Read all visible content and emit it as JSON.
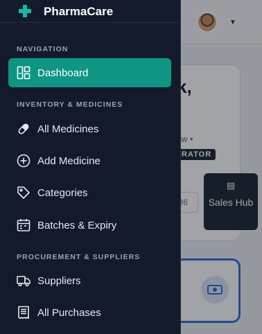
{
  "app": {
    "name": "PharmaCare"
  },
  "background": {
    "heading_line1": "k,",
    "heading_line2": "!",
    "subtitle": "rview •",
    "role_badge": "STRATOR",
    "pill_text": "36",
    "sales_hub_label": "Sales Hub"
  },
  "sidebar": {
    "sections": [
      {
        "title": "NAVIGATION",
        "items": [
          {
            "label": "Dashboard",
            "icon": "dashboard-icon",
            "active": true
          }
        ]
      },
      {
        "title": "INVENTORY & MEDICINES",
        "items": [
          {
            "label": "All Medicines",
            "icon": "pill-icon",
            "active": false
          },
          {
            "label": "Add Medicine",
            "icon": "plus-circle-icon",
            "active": false
          },
          {
            "label": "Categories",
            "icon": "tag-icon",
            "active": false
          },
          {
            "label": "Batches & Expiry",
            "icon": "calendar-icon",
            "active": false
          }
        ]
      },
      {
        "title": "PROCUREMENT & SUPPLIERS",
        "items": [
          {
            "label": "Suppliers",
            "icon": "truck-icon",
            "active": false
          },
          {
            "label": "All Purchases",
            "icon": "receipt-icon",
            "active": false
          }
        ]
      }
    ]
  },
  "colors": {
    "sidebar_bg": "#121a2b",
    "accent": "#0f9683",
    "brand_icon": "#14b8a6"
  }
}
